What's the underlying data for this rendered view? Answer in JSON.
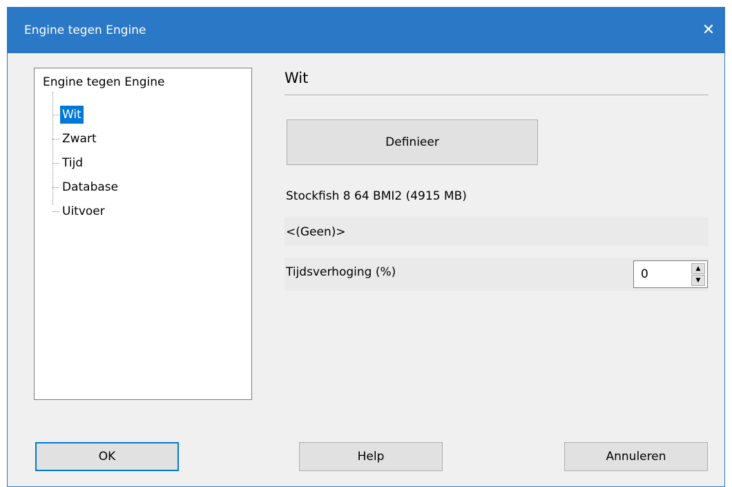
{
  "window": {
    "title": "Engine tegen Engine",
    "close_glyph": "✕"
  },
  "tree": {
    "root": "Engine tegen Engine",
    "items": [
      {
        "label": "Wit",
        "selected": true
      },
      {
        "label": "Zwart"
      },
      {
        "label": "Tijd"
      },
      {
        "label": "Database"
      },
      {
        "label": "Uitvoer"
      }
    ]
  },
  "panel": {
    "title": "Wit",
    "define_button": "Definieer",
    "engine_name": "Stockfish 8 64 BMI2  (4915 MB)",
    "book": "<(Geen)>",
    "time_increase_label": "Tijdsverhoging (%)",
    "time_increase_value": "0"
  },
  "footer": {
    "ok": "OK",
    "help": "Help",
    "cancel": "Annuleren"
  },
  "colors": {
    "titlebar": "#2b78c7",
    "selection": "#0078d7"
  }
}
